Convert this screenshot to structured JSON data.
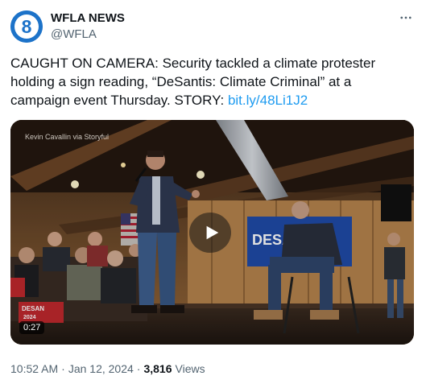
{
  "account": {
    "display_name": "WFLA NEWS",
    "handle": "@WFLA",
    "avatar_text": "8"
  },
  "tweet": {
    "text_before_link": "CAUGHT ON CAMERA: Security tackled a climate protester holding a sign reading, “DeSantis: Climate Criminal” at a campaign event Thursday. STORY: ",
    "link_text": "bit.ly/48Li1J2"
  },
  "media": {
    "credit": "Kevin Cavallin via Storyful",
    "duration": "0:27",
    "sign_text": "DESAN",
    "sign_text_2": "2",
    "small_sign_text": "DESAN",
    "small_sign_text_2": "2024"
  },
  "meta": {
    "time": "10:52 AM",
    "date": "Jan 12, 2024",
    "views_count": "3,816",
    "views_label": "Views"
  },
  "colors": {
    "link": "#1d9bf0",
    "avatar": "#1d73c9",
    "secondary_text": "#536471"
  },
  "icons": [
    "more-options-icon",
    "play-icon",
    "wfla-8-logo"
  ]
}
